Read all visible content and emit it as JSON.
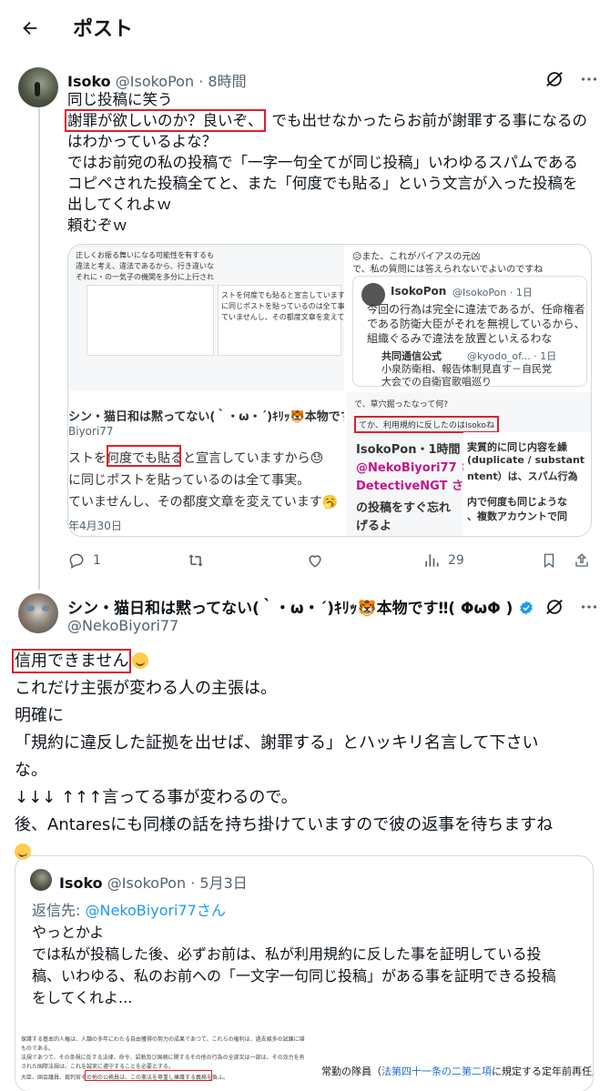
{
  "header": {
    "title": "ポスト"
  },
  "post1": {
    "display_name": "Isoko",
    "handle": "@IsokoPon",
    "sep": "·",
    "time": "8時間",
    "lines": [
      "同じ投稿に笑う",
      "謝罪が欲しいのか？良いぞ、",
      "でも出せなかったらお前が謝罪する事になるの",
      "はわかっているよな？",
      "ではお前宛の私の投稿で「一字一句全てが同じ投稿」いわゆるスパムである",
      "コピペされた投稿全てと、また「何度でも貼る」という文言が入った投稿を",
      "出してくれよｗ",
      "頼むぞｗ"
    ],
    "media": {
      "tl": [
        "正しくお振る舞いになる可能性を有するも",
        "違法と考え、違法であるから、行き違いな",
        "それに・の一気子の機関を多分に上行され",
        "ストを何度でも貼ると宣言していますから",
        "に同じポストを貼っているのは全て事実。",
        "ていませんし、その都度文章を変えています"
      ],
      "tr": [
        "😥また、これがバイアスの元凶",
        "で、私の質問には答えられないでよいのですね",
        "IsokoPon",
        "@IsokoPon · 1日",
        "今回の行為は完全に違法であるが、任命権者",
        "である防衛大臣がそれを無視しているから、",
        "組織ぐるみで違法を放置といえるわな",
        "共同通信公式",
        "@kyodo_of... · 1日",
        "小泉防衛相、報告体制見直す－自民党",
        "大会での自衛官歌唱巡り"
      ],
      "bl": [
        "シン・猫日和は黙ってない(｀・ω・´)ｷﾘｯ🐯本物です‼( ΦωΦ )",
        "Biyori77",
        "ストを何度でも貼ると宣言していますから😓",
        "に同じポストを貼っているのは全て事実。",
        "ていませんし、その都度文章を変えています🥱",
        "年4月30日"
      ],
      "br": [
        "で、草穴掘ったなって何?",
        "てか、利用規約に反したのはIsokoね",
        "IsokoPon・1時間",
        "@NekoBiyori77 さ",
        "DetectiveNGT さ",
        "の投稿をすぐ忘れ",
        "げるよ",
        "実質的に同じ内容を繰",
        "(duplicate / substant",
        "ntent）は、スパム行為",
        "内で何度も同じような",
        "、複数アカウントで同"
      ]
    },
    "actions": {
      "reply": "1",
      "retweet": "",
      "like": "",
      "views": "29"
    }
  },
  "post2": {
    "display_name": "シン・猫日和は黙ってない(｀・ω・´)ｷﾘｯ🐯本物です‼( ΦωΦ )",
    "handle": "@NekoBiyori77",
    "lines": [
      "信用できません",
      "これだけ主張が変わる人の主張は。",
      "明確に",
      "「規約に違反した証拠を出せば、謝罪する」とハッキリ名言して下さい",
      "な。",
      "↓↓↓ ↑↑↑言ってる事が変わるので。",
      "後、Antaresにも同様の話を持ち掛けていますので彼の返事を待ちますね"
    ],
    "quote": {
      "display_name": "Isoko",
      "handle": "@IsokoPon",
      "sep": "·",
      "date": "5月3日",
      "reply_to_label": "返信先:",
      "reply_to_handle": "@NekoBiyori77さん",
      "lines": [
        "やっとかよ",
        "では私が投稿した後、必ずお前は、私が利用規約に反した事を証明している投",
        "稿、いわゆる、私のお前への「一文字一句同じ投稿」がある事を証明できる投稿",
        "をしてくれよ..."
      ],
      "img_left": [
        "保護する基本的人権は、人類の多年にわたる自由獲得の努力の成果であつて、これらの権利は、過去幾多の試錬に堪へ、現在及び将来の",
        "ものである。",
        "法規であつて、その条規に反する法律、命令、詔勅及び国務に関するその他の行為の全部又は一部は、その効力を有しない。",
        "された国際法規は、これを誠実に遵守することを必要とする。",
        "大臣、国会議員、裁判官その他の公務員は、この憲法を尊重し擁護する義務を負ふ。"
      ],
      "img_right": [
        "常勤の隊員（",
        "法第四十一条の二第二項",
        "に規定する定年前再任用短時間"
      ]
    }
  },
  "colors": {
    "accent": "#1d9bf0",
    "highlight_box": "#e0202a",
    "verified": "#1d9bf0"
  }
}
